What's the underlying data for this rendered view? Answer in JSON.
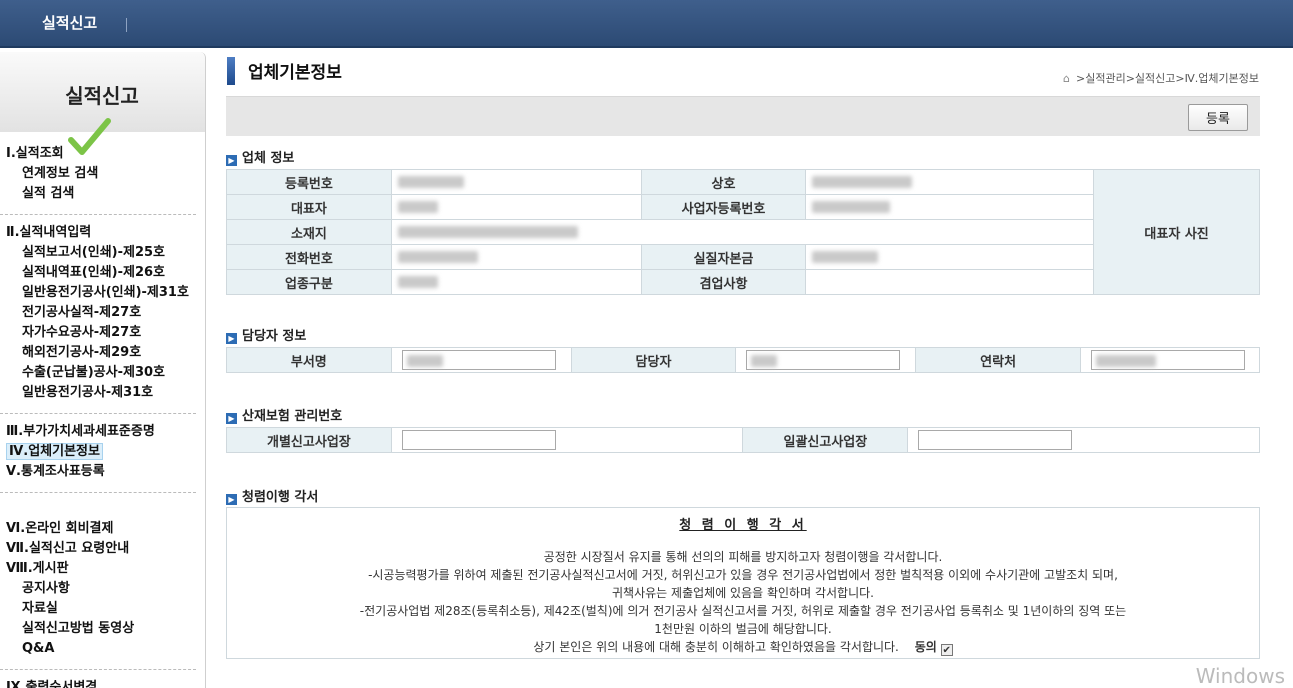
{
  "topbar": {
    "title": "실적신고"
  },
  "sidebar": {
    "title": "실적신고",
    "groups": [
      {
        "label": "Ⅰ.실적조회",
        "items": [
          "연계정보 검색",
          "실적 검색"
        ]
      },
      {
        "label": "Ⅱ.실적내역입력",
        "items": [
          "실적보고서(인쇄)-제25호",
          "실적내역표(인쇄)-제26호",
          "일반용전기공사(인쇄)-제31호",
          "전기공사실적-제27호",
          "자가수요공사-제27호",
          "해외전기공사-제29호",
          "수출(군납불)공사-제30호",
          "일반용전기공사-제31호"
        ]
      },
      {
        "label": "Ⅲ.부가가치세과세표준증명",
        "items": []
      },
      {
        "label": "Ⅳ.업체기본정보",
        "items": []
      },
      {
        "label": "Ⅴ.통계조사표등록",
        "items": []
      },
      {
        "label": "Ⅵ.온라인 회비결제",
        "items": []
      },
      {
        "label": "Ⅶ.실적신고 요령안내",
        "items": []
      },
      {
        "label": "Ⅷ.게시판",
        "items": [
          "공지사항",
          "자료실",
          "실적신고방법 동영상",
          "Q&A"
        ]
      },
      {
        "label": "Ⅸ.출력순서변경",
        "items": []
      }
    ]
  },
  "page": {
    "title": "업체기본정보",
    "breadcrumb": ">실적관리>실적신고>Ⅳ.업체기본정보",
    "register_label": "등록"
  },
  "company": {
    "section_title": "업체 정보",
    "labels": {
      "reg_no": "등록번호",
      "name": "상호",
      "ceo": "대표자",
      "biz_no": "사업자등록번호",
      "address": "소재지",
      "phone": "전화번호",
      "capital": "실질자본금",
      "type": "업종구분",
      "side_biz": "겸업사항",
      "photo": "대표자 사진"
    }
  },
  "manager": {
    "section_title": "담당자 정보",
    "labels": {
      "dept": "부서명",
      "person": "담당자",
      "contact": "연락처"
    }
  },
  "insurance": {
    "section_title": "산재보험 관리번호",
    "labels": {
      "individual": "개별신고사업장",
      "bulk": "일괄신고사업장"
    }
  },
  "pledge": {
    "section_title": "청렴이행 각서",
    "heading": "청 렴 이 행 각 서",
    "lines": [
      "공정한 시장질서 유지를 통해 선의의 피해를 방지하고자 청렴이행을 각서합니다.",
      "-시공능력평가를 위하여 제출된 전기공사실적신고서에 거짓, 허위신고가 있을 경우 전기공사업법에서 정한 벌칙적용 이외에 수사기관에 고발조치 되며,",
      "귀책사유는 제출업체에 있음을 확인하며 각서합니다.",
      "-전기공사업법 제28조(등록취소등), 제42조(벌칙)에 의거 전기공사 실적신고서를 거짓, 허위로 제출할 경우 전기공사업 등록취소 및 1년이하의 징역 또는",
      "1천만원 이하의 벌금에 해당합니다."
    ],
    "closing": "상기 본인은 위의 내용에 대해 충분히 이해하고 확인하였음을 각서합니다.",
    "agree_label": "동의",
    "agree_checked": true
  },
  "watermark": "Windows"
}
